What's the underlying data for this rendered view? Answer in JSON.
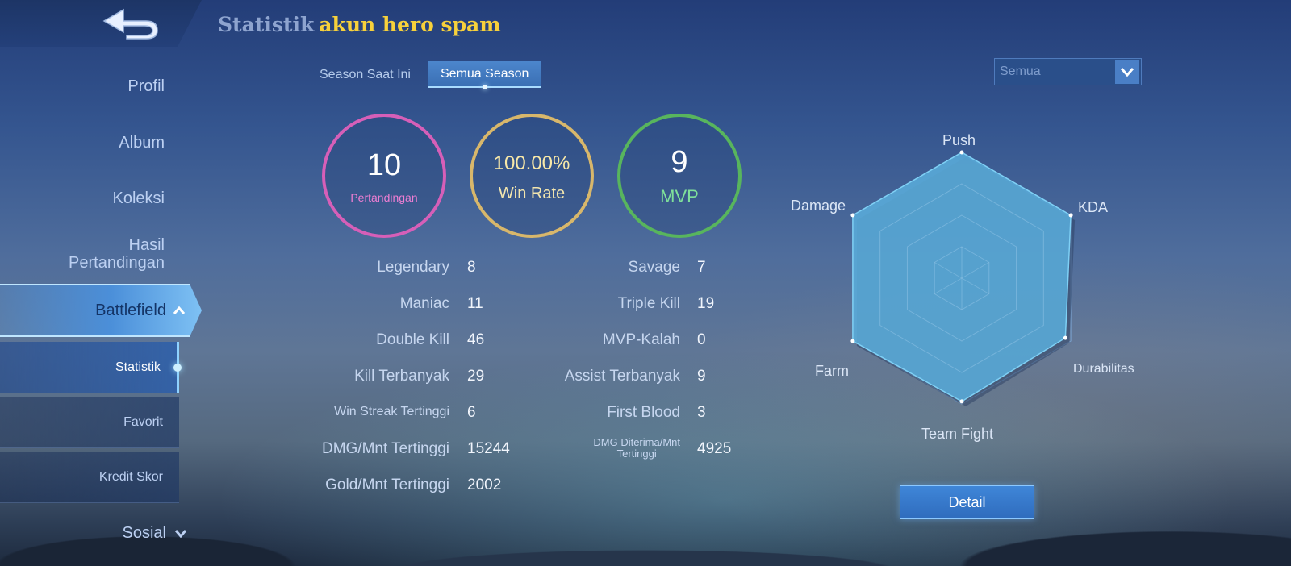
{
  "header": {
    "title_prefix": "Statistik",
    "title_name": "akun hero spam"
  },
  "sidebar": {
    "items": [
      {
        "label": "Profil"
      },
      {
        "label": "Album"
      },
      {
        "label": "Koleksi"
      },
      {
        "label": "Hasil\nPertandingan"
      },
      {
        "label": "Battlefield"
      },
      {
        "label": "Sosial"
      }
    ],
    "subitems": [
      {
        "label": "Statistik"
      },
      {
        "label": "Favorit"
      },
      {
        "label": "Kredit Skor"
      }
    ]
  },
  "tabs": {
    "current_season": "Season Saat Ini",
    "all_seasons": "Semua Season"
  },
  "filter": {
    "selected": "Semua"
  },
  "summary": {
    "matches": {
      "value": "10",
      "label": "Pertandingan"
    },
    "winrate": {
      "value": "100.00%",
      "label": "Win Rate"
    },
    "mvp": {
      "value": "9",
      "label": "MVP"
    }
  },
  "stats_left": [
    {
      "label": "Legendary",
      "value": "8"
    },
    {
      "label": "Maniac",
      "value": "11"
    },
    {
      "label": "Double Kill",
      "value": "46"
    },
    {
      "label": "Kill Terbanyak",
      "value": "29"
    },
    {
      "label": "Win Streak Tertinggi",
      "value": "6"
    },
    {
      "label": "DMG/Mnt Tertinggi",
      "value": "15244"
    },
    {
      "label": "Gold/Mnt Tertinggi",
      "value": "2002"
    }
  ],
  "stats_right": [
    {
      "label": "Savage",
      "value": "7"
    },
    {
      "label": "Triple Kill",
      "value": "19"
    },
    {
      "label": "MVP-Kalah",
      "value": "0"
    },
    {
      "label": "Assist Terbanyak",
      "value": "9"
    },
    {
      "label": "First Blood",
      "value": "3"
    },
    {
      "label": "DMG Diterima/Mnt\nTertinggi",
      "value": "4925"
    }
  ],
  "radar": {
    "labels": {
      "push": "Push",
      "kda": "KDA",
      "durabilitas": "Durabilitas",
      "team_fight": "Team Fight",
      "farm": "Farm",
      "damage": "Damage"
    },
    "values": {
      "push": 1.0,
      "kda": 1.0,
      "durabilitas": 0.95,
      "team_fight": 0.98,
      "farm": 1.0,
      "damage": 1.0
    },
    "fill_color": "#5aaedc"
  },
  "detail_button": "Detail"
}
